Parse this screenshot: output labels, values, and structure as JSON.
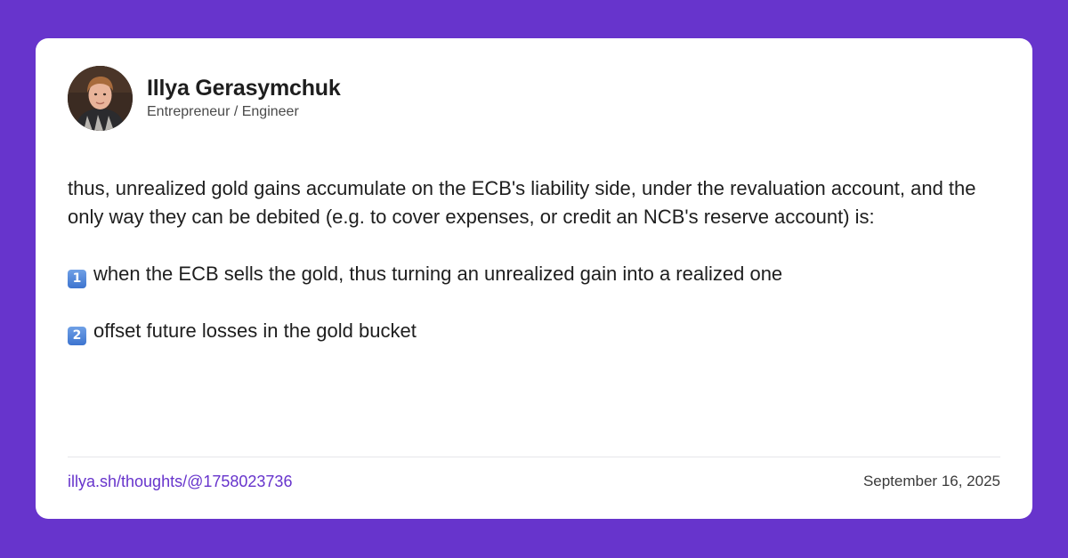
{
  "colors": {
    "background": "#6734cc",
    "card": "#ffffff",
    "link": "#6734cc",
    "text": "#1e1e1e",
    "muted": "#4a4a4a"
  },
  "author": {
    "avatar_icon": "profile-photo",
    "name": "Illya Gerasymchuk",
    "title": "Entrepreneur / Engineer"
  },
  "post": {
    "paragraph": "thus, unrealized gold gains accumulate on the ECB's liability side, under the revaluation account, and the only way they can be debited (e.g. to cover expenses, or credit an NCB's reserve account) is:",
    "items": [
      {
        "badge": "1",
        "text": "when the ECB sells the gold, thus turning an unrealized gain into a realized one"
      },
      {
        "badge": "2",
        "text": "offset future losses in the gold bucket"
      }
    ]
  },
  "footer": {
    "link": "illya.sh/thoughts/@1758023736",
    "date": "September 16, 2025"
  }
}
